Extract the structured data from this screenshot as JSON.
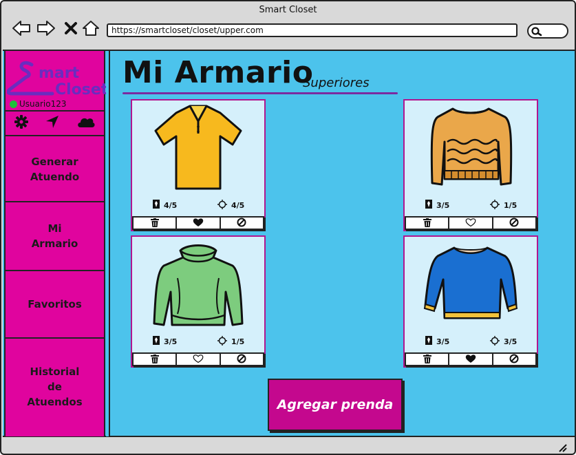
{
  "window": {
    "title": "Smart Closet"
  },
  "browser": {
    "url": "https://smartcloset/closet/upper.com",
    "icons": [
      "back-arrow-icon",
      "forward-arrow-icon",
      "close-icon",
      "home-icon",
      "search-icon"
    ]
  },
  "sidebar": {
    "logo": {
      "line1": "mart",
      "line2": "Closet"
    },
    "user": "Usuario123",
    "icons": [
      "gear-icon",
      "location-arrow-icon",
      "cloud-icon"
    ],
    "items": [
      {
        "label": "Generar\nAtuendo"
      },
      {
        "label": "Mi\nArmario"
      },
      {
        "label": "Favoritos"
      },
      {
        "label": "Historial\nde\nAtuendos"
      }
    ]
  },
  "main": {
    "title": "Mi Armario",
    "subtitle": "Superiores",
    "items": [
      {
        "name": "yellow polo shirt",
        "formality": "4/5",
        "warmth": "4/5",
        "favorite": true
      },
      {
        "name": "orange sweater",
        "formality": "3/5",
        "warmth": "1/5",
        "favorite": false
      },
      {
        "name": "green turtleneck",
        "formality": "3/5",
        "warmth": "1/5",
        "favorite": false
      },
      {
        "name": "blue sweater",
        "formality": "3/5",
        "warmth": "3/5",
        "favorite": true
      }
    ],
    "add_button": "Agregar prenda"
  },
  "colors": {
    "background": "#4cc3ec",
    "sidebar": "#e0049e",
    "card": "#d5f0fb",
    "card_border": "#b1168f",
    "button": "#c4088e",
    "logo": "#6a2dbf"
  }
}
